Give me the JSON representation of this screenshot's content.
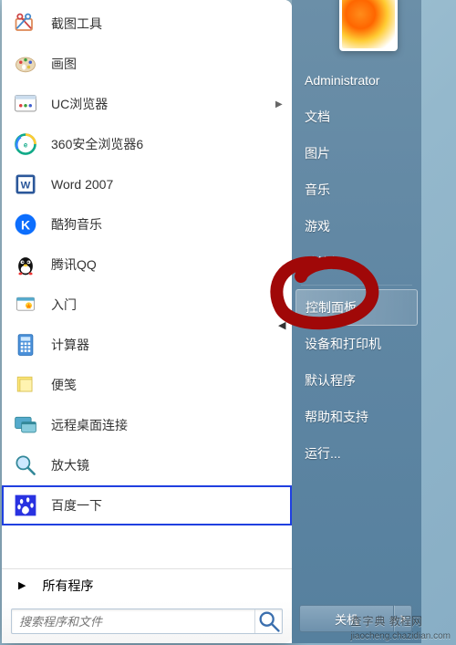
{
  "user": {
    "name": "Administrator"
  },
  "programs": [
    {
      "label": "截图工具",
      "icon": "snip",
      "expand": false
    },
    {
      "label": "画图",
      "icon": "paint",
      "expand": false
    },
    {
      "label": "UC浏览器",
      "icon": "uc",
      "expand": true
    },
    {
      "label": "360安全浏览器6",
      "icon": "360",
      "expand": false
    },
    {
      "label": "Word 2007",
      "icon": "word",
      "expand": false
    },
    {
      "label": "酷狗音乐",
      "icon": "kugou",
      "expand": false
    },
    {
      "label": "腾讯QQ",
      "icon": "qq",
      "expand": false
    },
    {
      "label": "入门",
      "icon": "start",
      "expand": false
    },
    {
      "label": "计算器",
      "icon": "calc",
      "expand": false
    },
    {
      "label": "便笺",
      "icon": "notes",
      "expand": false
    },
    {
      "label": "远程桌面连接",
      "icon": "rdp",
      "expand": false
    },
    {
      "label": "放大镜",
      "icon": "magnifier",
      "expand": false
    },
    {
      "label": "百度一下",
      "icon": "baidu",
      "expand": false,
      "highlighted": true
    }
  ],
  "all_programs": "所有程序",
  "search": {
    "placeholder": "搜索程序和文件"
  },
  "right_items": [
    {
      "label": "文档",
      "key": "documents"
    },
    {
      "label": "图片",
      "key": "pictures"
    },
    {
      "label": "音乐",
      "key": "music"
    },
    {
      "label": "游戏",
      "key": "games"
    },
    {
      "label": "计算机",
      "key": "computer",
      "sep_after": true
    },
    {
      "label": "控制面板",
      "key": "control-panel",
      "highlighted": true
    },
    {
      "label": "设备和打印机",
      "key": "devices-printers"
    },
    {
      "label": "默认程序",
      "key": "default-programs"
    },
    {
      "label": "帮助和支持",
      "key": "help"
    },
    {
      "label": "运行...",
      "key": "run"
    }
  ],
  "shutdown": {
    "label": "关机"
  },
  "annotation_color": "#a00808",
  "watermark": {
    "site": "查字典",
    "sub": "教程网",
    "url": "jiaocheng.chazidian.com"
  }
}
